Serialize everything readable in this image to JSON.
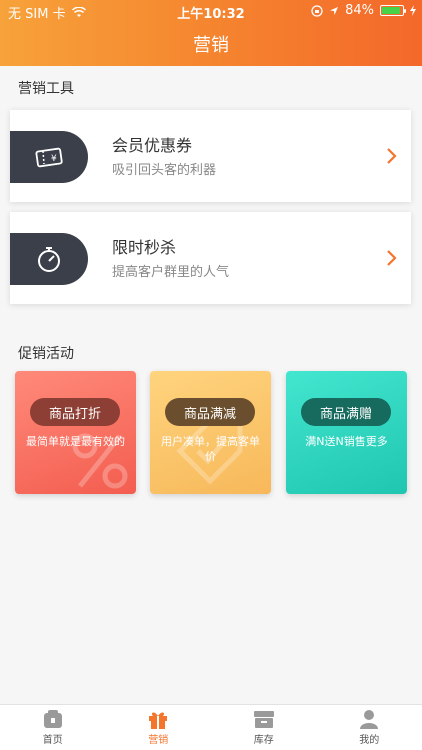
{
  "status_bar": {
    "carrier": "无 SIM 卡",
    "time": "上午10:32",
    "battery": "84%",
    "battery_level": 0.84
  },
  "nav": {
    "title": "营销"
  },
  "tools_section": {
    "title": "营销工具",
    "items": [
      {
        "name": "会员优惠券",
        "desc": "吸引回头客的利器",
        "icon": "coupon-icon"
      },
      {
        "name": "限时秒杀",
        "desc": "提高客户群里的人气",
        "icon": "stopwatch-icon"
      }
    ]
  },
  "promo_section": {
    "title": "促销活动",
    "items": [
      {
        "label": "商品打折",
        "desc": "最简单就是最有效的",
        "color": "#f35d4f"
      },
      {
        "label": "商品满减",
        "desc": "用户凑单，提高客单价",
        "color": "#f7b85a"
      },
      {
        "label": "商品满赠",
        "desc": "满N送N销售更多",
        "color": "#20c6b0"
      }
    ]
  },
  "tab_bar": {
    "items": [
      {
        "label": "首页",
        "icon": "home-icon"
      },
      {
        "label": "营销",
        "icon": "gift-icon",
        "active": true
      },
      {
        "label": "库存",
        "icon": "inventory-icon"
      },
      {
        "label": "我的",
        "icon": "profile-icon"
      }
    ],
    "accent": "#f4752c"
  }
}
